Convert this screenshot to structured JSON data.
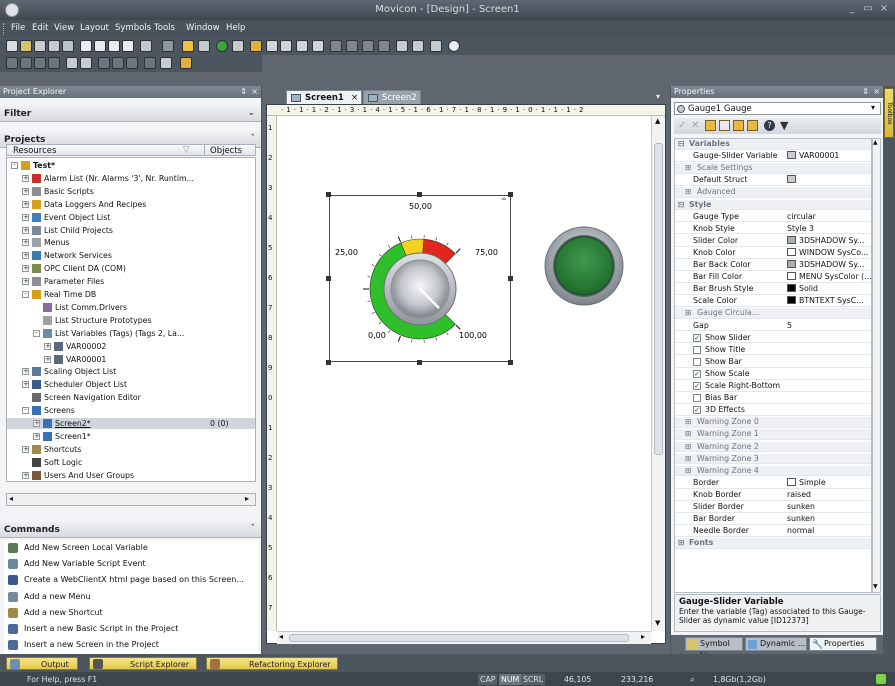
{
  "window": {
    "title": "Movicon - [Design] - Screen1",
    "controls": [
      "_",
      "▭",
      "×"
    ]
  },
  "menu": [
    "File",
    "Edit",
    "View",
    "Layout",
    "Symbols",
    "Tools",
    "Window",
    "Help"
  ],
  "project_explorer": {
    "header": "Project Explorer",
    "filter_label": "Filter",
    "projects_label": "Projects",
    "columns": [
      "Resources",
      "Objects"
    ],
    "tree": [
      {
        "label": "Test*",
        "level": 0,
        "exp": "-",
        "icon": "gear",
        "bold": true
      },
      {
        "label": "Alarm List (Nr. Alarms '3', Nr. Runtim...",
        "level": 1,
        "exp": "+",
        "icon": "alarm"
      },
      {
        "label": "Basic Scripts",
        "level": 1,
        "exp": "+",
        "icon": "doc"
      },
      {
        "label": "Data Loggers And Recipes",
        "level": 1,
        "exp": "+",
        "icon": "db"
      },
      {
        "label": "Event Object List",
        "level": 1,
        "exp": "+",
        "icon": "event"
      },
      {
        "label": "List Child Projects",
        "level": 1,
        "exp": "+",
        "icon": "child"
      },
      {
        "label": "Menus",
        "level": 1,
        "exp": "+",
        "icon": "menu"
      },
      {
        "label": "Network Services",
        "level": 1,
        "exp": "+",
        "icon": "net"
      },
      {
        "label": "OPC Client DA (COM)",
        "level": 1,
        "exp": "+",
        "icon": "opc"
      },
      {
        "label": "Parameter Files",
        "level": 1,
        "exp": "+",
        "icon": "doc"
      },
      {
        "label": "Real Time DB",
        "level": 1,
        "exp": "-",
        "icon": "gear"
      },
      {
        "label": "List Comm.Drivers",
        "level": 2,
        "exp": "",
        "icon": "driver"
      },
      {
        "label": "List Structure Prototypes",
        "level": 2,
        "exp": "",
        "icon": "struct"
      },
      {
        "label": "List Variables (Tags) (Tags 2, La...",
        "level": 2,
        "exp": "-",
        "icon": "vars"
      },
      {
        "label": "VAR00002",
        "level": 3,
        "exp": "+",
        "icon": "var"
      },
      {
        "label": "VAR00001",
        "level": 3,
        "exp": "+",
        "icon": "var"
      },
      {
        "label": "Scaling Object List",
        "level": 1,
        "exp": "+",
        "icon": "scale"
      },
      {
        "label": "Scheduler Object List",
        "level": 1,
        "exp": "+",
        "icon": "sched"
      },
      {
        "label": "Screen Navigation Editor",
        "level": 1,
        "exp": "",
        "icon": "nav"
      },
      {
        "label": "Screens",
        "level": 1,
        "exp": "-",
        "icon": "screen"
      },
      {
        "label": "Screen2*",
        "level": 2,
        "exp": "+",
        "icon": "screen",
        "objects": "0 (0)",
        "selected": true,
        "underline": true
      },
      {
        "label": "Screen1*",
        "level": 2,
        "exp": "+",
        "icon": "screen"
      },
      {
        "label": "Shortcuts",
        "level": 1,
        "exp": "+",
        "icon": "shortcut"
      },
      {
        "label": "Soft Logic",
        "level": 1,
        "exp": "",
        "icon": "logic"
      },
      {
        "label": "Users And User Groups",
        "level": 1,
        "exp": "+",
        "icon": "users"
      }
    ]
  },
  "commands": {
    "header": "Commands",
    "items": [
      "Add New Screen Local Variable",
      "Add New Variable Script Event",
      "Create a WebClientX html page based on this Screen...",
      "Add a new Menu",
      "Add a new Shortcut",
      "Insert a new Basic Script in the Project",
      "Insert a new Screen in the Project"
    ]
  },
  "editor": {
    "tabs": [
      {
        "label": "Screen1",
        "active": true
      },
      {
        "label": "Screen2",
        "active": false
      }
    ],
    "close_glyph": "×",
    "ruler": "· 1 · 1 · 1 · 2 · 1 · 3 · 1 · 4 · 1 · 5 · 1 · 6 · 1 · 7 · 1 · 8 · 1 · 9 · 1 · 0 · 1 · 1 · 1 · 2",
    "vruler": [
      "1",
      "2",
      "3",
      "4",
      "5",
      "6",
      "7",
      "8",
      "9",
      "0",
      "1",
      "2",
      "3",
      "4",
      "5",
      "6",
      "7"
    ],
    "gauge": {
      "labels": [
        "0,00",
        "25,00",
        "50,00",
        "75,00",
        "100,00"
      ],
      "value": 0,
      "min": 0,
      "max": 100,
      "green_until": 75,
      "yellow_until": 85
    }
  },
  "properties": {
    "header": "Properties",
    "object": "Gauge1 Gauge",
    "rows": [
      {
        "t": "grp",
        "k": "Variables",
        "exp": "-"
      },
      {
        "k": "Gauge-Slider Variable",
        "v": "VAR00001"
      },
      {
        "t": "sub",
        "k": "Scale Settings",
        "exp": "+"
      },
      {
        "k": "Default Struct",
        "v": ""
      },
      {
        "t": "sub",
        "k": "Advanced",
        "exp": "+"
      },
      {
        "t": "grp",
        "k": "Style",
        "exp": "-"
      },
      {
        "k": "Gauge Type",
        "v": "circular"
      },
      {
        "k": "Knob Style",
        "v": "Style 3"
      },
      {
        "k": "Slider Color",
        "v": "3DSHADOW Sy...",
        "sw": "#a8aeb4"
      },
      {
        "k": "Knob Color",
        "v": "WINDOW SysCo...",
        "sw": "#ffffff"
      },
      {
        "k": "Bar Back Color",
        "v": "3DSHADOW Sy...",
        "sw": "#a8aeb4"
      },
      {
        "k": "Bar Fill Color",
        "v": "MENU SysColor (...",
        "sw": "#ffffff"
      },
      {
        "k": "Bar Brush Style",
        "v": "Solid",
        "sw": "#000000"
      },
      {
        "k": "Scale Color",
        "v": "BTNTEXT SysC...",
        "sw": "#000000"
      },
      {
        "t": "sub",
        "k": "Gauge Circula...",
        "exp": "+"
      },
      {
        "k": "Gap",
        "v": "5"
      },
      {
        "k": "Show Slider",
        "chk": true
      },
      {
        "k": "Show Title",
        "chk": false
      },
      {
        "k": "Show Bar",
        "chk": false
      },
      {
        "k": "Show Scale",
        "chk": true
      },
      {
        "k": "Scale Right-Bottom",
        "chk": true
      },
      {
        "k": "Bias Bar",
        "chk": false
      },
      {
        "k": "3D Effects",
        "chk": true
      },
      {
        "t": "sub",
        "k": "Warning Zone 0",
        "exp": "+"
      },
      {
        "t": "sub",
        "k": "Warning Zone 1",
        "exp": "+"
      },
      {
        "t": "sub",
        "k": "Warning Zone 2",
        "exp": "+"
      },
      {
        "t": "sub",
        "k": "Warning Zone 3",
        "exp": "+"
      },
      {
        "t": "sub",
        "k": "Warning Zone 4",
        "exp": "+"
      },
      {
        "k": "Border",
        "v": "Simple",
        "box": true
      },
      {
        "k": "Knob Border",
        "v": "raised"
      },
      {
        "k": "Slider Border",
        "v": "sunken"
      },
      {
        "k": "Bar Border",
        "v": "sunken"
      },
      {
        "k": "Needle Border",
        "v": "normal"
      },
      {
        "t": "grp",
        "k": "Fonts",
        "exp": "+"
      }
    ],
    "help_title": "Gauge-Slider Variable",
    "help_text": "Enter the variable (Tag) associated to this Gauge-Slider as dynamic value [ID12373]",
    "bottom_tabs": [
      "Symbol Li...",
      "Dynamic ...",
      "Properties"
    ],
    "side_tab": "Toolbox"
  },
  "bottom_tabs": [
    "Output",
    "Script Explorer",
    "Refactoring Explorer"
  ],
  "status": {
    "help": "For Help, press F1",
    "cap": "CAP",
    "num": "NUM",
    "scrl": "SCRL",
    "coords": "46,105",
    "size": "233,216",
    "memory": "1,8Gb(1,2Gb)"
  }
}
